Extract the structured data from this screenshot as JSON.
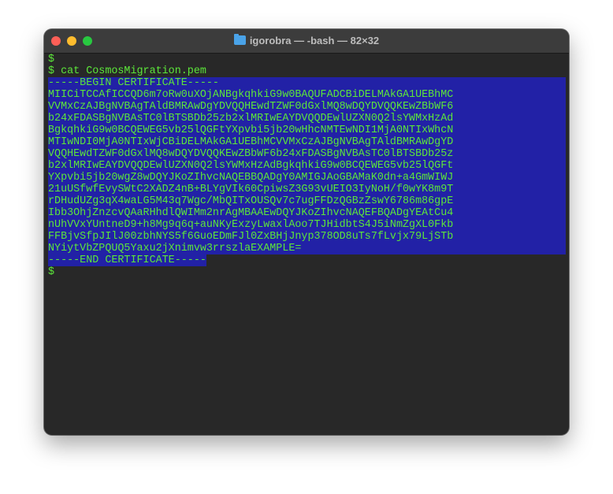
{
  "window": {
    "title": "igorobra — -bash — 82×32"
  },
  "terminal": {
    "lines": [
      {
        "text": "$",
        "selected": "none"
      },
      {
        "text": "$ cat CosmosMigration.pem",
        "selected": "none"
      },
      {
        "text": "-----BEGIN CERTIFICATE-----",
        "selected": "full"
      },
      {
        "text": "MIICiTCCAfICCQD6m7oRw0uXOjANBgkqhkiG9w0BAQUFADCBiDELMAkGA1UEBhMC",
        "selected": "full"
      },
      {
        "text": "VVMxCzAJBgNVBAgTAldBMRAwDgYDVQQHEwdTZWF0dGxlMQ8wDQYDVQQKEwZBbWF6",
        "selected": "full"
      },
      {
        "text": "b24xFDASBgNVBAsTC0lBTSBDb25zb2xlMRIwEAYDVQQDEwlUZXN0Q2lsYWMxHzAd",
        "selected": "full"
      },
      {
        "text": "BgkqhkiG9w0BCQEWEG5vb25lQGFtYXpvbi5jb20wHhcNMTEwNDI1MjA0NTIxWhcN",
        "selected": "full"
      },
      {
        "text": "MTIwNDI0MjA0NTIxWjCBiDELMAkGA1UEBhMCVVMxCzAJBgNVBAgTAldBMRAwDgYD",
        "selected": "full"
      },
      {
        "text": "VQQHEwdTZWF0dGxlMQ8wDQYDVQQKEwZBbWF6b24xFDASBgNVBAsTC0lBTSBDb25z",
        "selected": "full"
      },
      {
        "text": "b2xlMRIwEAYDVQQDEwlUZXN0Q2lsYWMxHzAdBgkqhkiG9w0BCQEWEG5vb25lQGFt",
        "selected": "full"
      },
      {
        "text": "YXpvbi5jb20wgZ8wDQYJKoZIhvcNAQEBBQADgY0AMIGJAoGBAMaK0dn+a4GmWIWJ",
        "selected": "full"
      },
      {
        "text": "21uUSfwfEvySWtC2XADZ4nB+BLYgVIk60CpiwsZ3G93vUEIO3IyNoH/f0wYK8m9T",
        "selected": "full"
      },
      {
        "text": "rDHudUZg3qX4waLG5M43q7Wgc/MbQITxOUSQv7c7ugFFDzQGBzZswY6786m86gpE",
        "selected": "full"
      },
      {
        "text": "Ibb3OhjZnzcvQAaRHhdlQWIMm2nrAgMBAAEwDQYJKoZIhvcNAQEFBQADgYEAtCu4",
        "selected": "full"
      },
      {
        "text": "nUhVVxYUntneD9+h8Mg9q6q+auNKyExzyLwaxlAoo7TJHidbtS4J5iNmZgXL0Fkb",
        "selected": "full"
      },
      {
        "text": "FFBjvSfpJIlJ00zbhNYS5f6GuoEDmFJl0ZxBHjJnyp378OD8uTs7fLvjx79LjSTb",
        "selected": "full"
      },
      {
        "text": "NYiytVbZPQUQ5Yaxu2jXnimvw3rrszlaEXAMPLE=",
        "selected": "full"
      },
      {
        "text": "-----END CERTIFICATE-----",
        "selected": "partial"
      },
      {
        "text": "$",
        "selected": "none"
      }
    ]
  },
  "colors": {
    "text": "#5ce63a",
    "selection": "#2221a6",
    "background": "#282828"
  }
}
